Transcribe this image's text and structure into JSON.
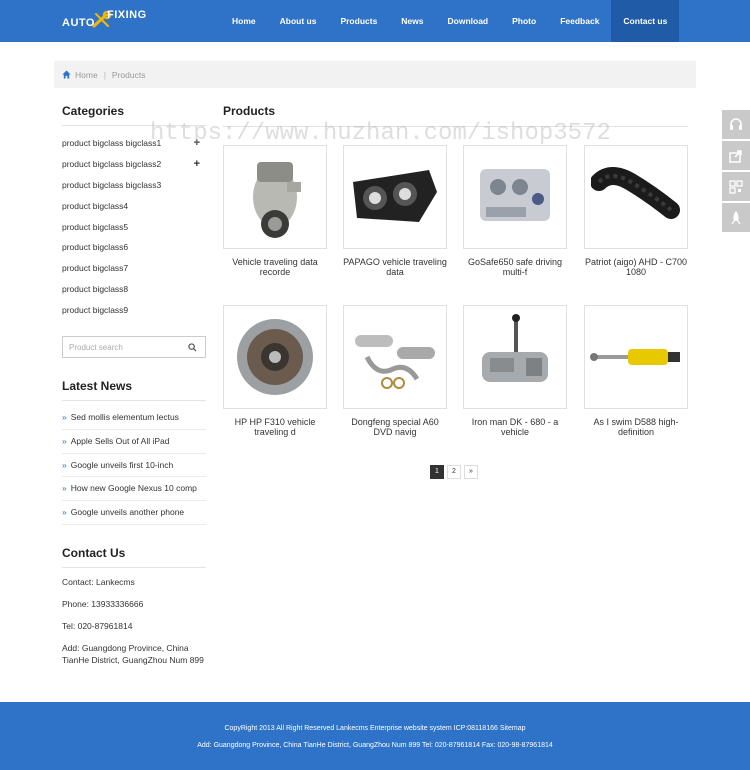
{
  "header": {
    "logo_auto": "AUTO",
    "logo_fixing": "FIXING",
    "nav": [
      "Home",
      "About us",
      "Products",
      "News",
      "Download",
      "Photo",
      "Feedback",
      "Contact us"
    ],
    "active_nav": "Contact us"
  },
  "breadcrumb": {
    "home": "Home",
    "current": "Products"
  },
  "sidebar": {
    "categories_title": "Categories",
    "categories": [
      "product bigclass bigclass1",
      "product bigclass bigclass2",
      "product bigclass bigclass3",
      "product bigclass4",
      "product bigclass5",
      "product bigclass6",
      "product bigclass7",
      "product bigclass8",
      "product bigclass9"
    ],
    "search_placeholder": "Product search",
    "news_title": "Latest News",
    "news": [
      "Sed mollis elementum lectus",
      "Apple Sells Out of All iPad",
      "Google unveils first 10-inch",
      "How new Google Nexus 10 comp",
      "Google unveils another phone"
    ],
    "contact_title": "Contact Us",
    "contact": {
      "contact": "Contact: Lankecms",
      "phone": "Phone: 13933336666",
      "tel": "Tel: 020-87961814",
      "address": "Add: Guangdong Province, China TianHe District, GuangZhou Num 899"
    }
  },
  "main": {
    "title": "Products",
    "products": [
      {
        "name": "Vehicle traveling data recorde",
        "icon": "supercharger-image"
      },
      {
        "name": "PAPAGO vehicle traveling data",
        "icon": "headlight-image"
      },
      {
        "name": "GoSafe650 safe driving multi-f",
        "icon": "engine-block-image"
      },
      {
        "name": "Patriot (aigo) AHD - C700 1080",
        "icon": "intake-hose-image"
      },
      {
        "name": "HP HP F310 vehicle traveling d",
        "icon": "gearbox-image"
      },
      {
        "name": "Dongfeng special A60 DVD navig",
        "icon": "exhaust-system-image"
      },
      {
        "name": "Iron man DK - 680 - a vehicle",
        "icon": "transmission-image"
      },
      {
        "name": "As I swim D588 high-definition",
        "icon": "shock-absorber-image"
      }
    ],
    "pagination": [
      "1",
      "2",
      "»"
    ],
    "current_page": "1"
  },
  "footer": {
    "line1": "CopyRight 2013 All Right Reserved Lankecms Enterprise website system ICP:08118166 Sitemap",
    "line2": "Add: Guangdong Province, China TianHe District, GuangZhou Num 899  Tel: 020-87961814  Fax: 020-98-87961814"
  },
  "watermark": "https://www.huzhan.com/ishop3572",
  "colors": {
    "brand_blue": "#2e73c7",
    "nav_active": "#1f5ba6"
  }
}
